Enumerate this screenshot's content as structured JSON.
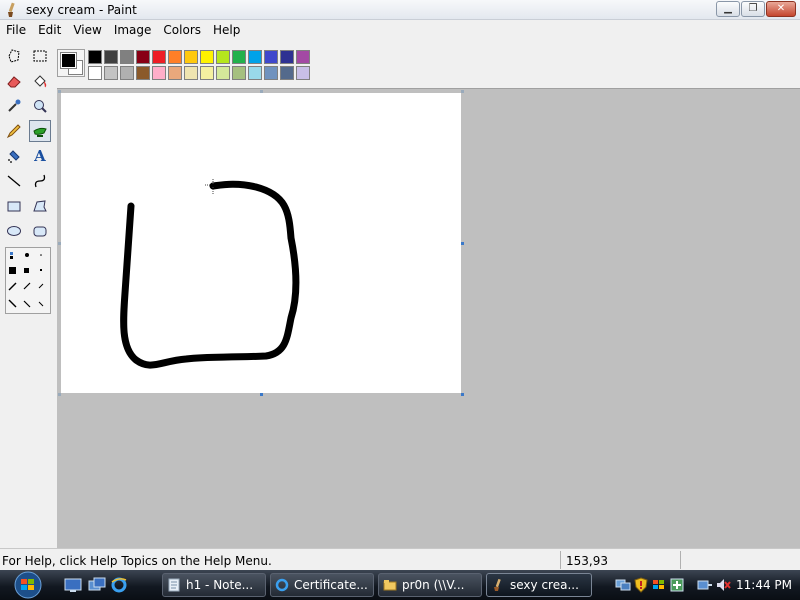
{
  "window": {
    "title": "sexy cream - Paint",
    "controls": [
      "minimize",
      "maximize",
      "close"
    ]
  },
  "menu": [
    "File",
    "Edit",
    "View",
    "Image",
    "Colors",
    "Help"
  ],
  "tools": [
    {
      "name": "free-select",
      "icon": "free-select-icon"
    },
    {
      "name": "select",
      "icon": "select-icon"
    },
    {
      "name": "eraser",
      "icon": "eraser-icon"
    },
    {
      "name": "fill",
      "icon": "fill-bucket-icon"
    },
    {
      "name": "pick-color",
      "icon": "eyedropper-icon"
    },
    {
      "name": "magnifier",
      "icon": "magnifier-icon"
    },
    {
      "name": "pencil",
      "icon": "pencil-icon"
    },
    {
      "name": "brush",
      "icon": "brush-icon",
      "active": true
    },
    {
      "name": "airbrush",
      "icon": "airbrush-icon"
    },
    {
      "name": "text",
      "icon": "text-icon",
      "glyph": "A"
    },
    {
      "name": "line",
      "icon": "line-icon"
    },
    {
      "name": "curve",
      "icon": "curve-icon"
    },
    {
      "name": "rectangle",
      "icon": "rectangle-icon"
    },
    {
      "name": "polygon",
      "icon": "polygon-icon"
    },
    {
      "name": "ellipse",
      "icon": "ellipse-icon"
    },
    {
      "name": "rounded-rectangle",
      "icon": "rounded-rectangle-icon"
    }
  ],
  "colors": {
    "foreground": "#000000",
    "background": "#ffffff",
    "palette_top": [
      "#000000",
      "#404040",
      "#808080",
      "#880015",
      "#ed1c24",
      "#ff7f27",
      "#ffc90e",
      "#fff200",
      "#b5e61d",
      "#22b14c",
      "#00a2e8",
      "#3f48cc",
      "#2e3192",
      "#a349a4"
    ],
    "palette_bottom": [
      "#ffffff",
      "#c3c3c3",
      "#b0b0b0",
      "#8b5a2b",
      "#ffaec9",
      "#e8a87c",
      "#efe4b0",
      "#f5f0a0",
      "#d4e89a",
      "#a5c080",
      "#99d9ea",
      "#7092be",
      "#546a8c",
      "#c8bfe7"
    ]
  },
  "status": {
    "help_text": "For Help, click Help Topics on the Help Menu.",
    "coords": "153,93"
  },
  "taskbar": {
    "buttons": [
      {
        "label": "h1 - Note...",
        "icon": "notepad-icon"
      },
      {
        "label": "Certificate...",
        "icon": "ie-icon"
      },
      {
        "label": "pr0n (\\\\V...",
        "icon": "folder-icon"
      },
      {
        "label": "sexy crea...",
        "icon": "paint-icon",
        "active": true
      }
    ],
    "clock": "11:44 PM"
  }
}
